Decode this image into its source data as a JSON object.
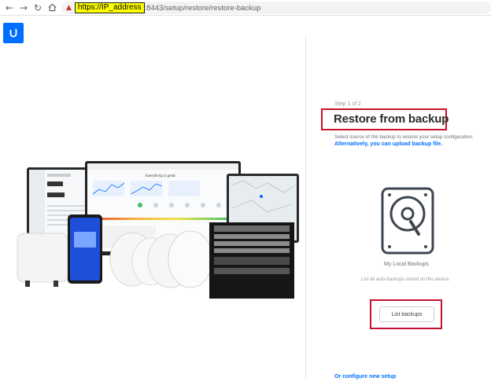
{
  "browser": {
    "url_highlighted": "https://IP_address",
    "url_rest": ":8443/setup/restore/restore-backup"
  },
  "icons": {
    "back": "arrow-left-icon",
    "forward": "arrow-right-icon",
    "reload": "reload-icon",
    "home": "home-icon",
    "warning": "warning-icon",
    "logo": "ubiquiti-logo",
    "drive": "hard-drive-icon"
  },
  "colors": {
    "accent": "#006fff",
    "highlight_box": "#c8102e",
    "url_highlight": "#ffff00"
  },
  "restore": {
    "step": "Step 1 of 2",
    "title": "Restore from backup",
    "description": "Select source of the backup to restore your setup configuration.",
    "upload_link": "Alternatively, you can upload backup file.",
    "local_backups_label": "My Local Backups",
    "list_hint": "List all auto-backups stored on this device.",
    "list_button": "List backups",
    "configure_link": "Or configure new setup"
  }
}
